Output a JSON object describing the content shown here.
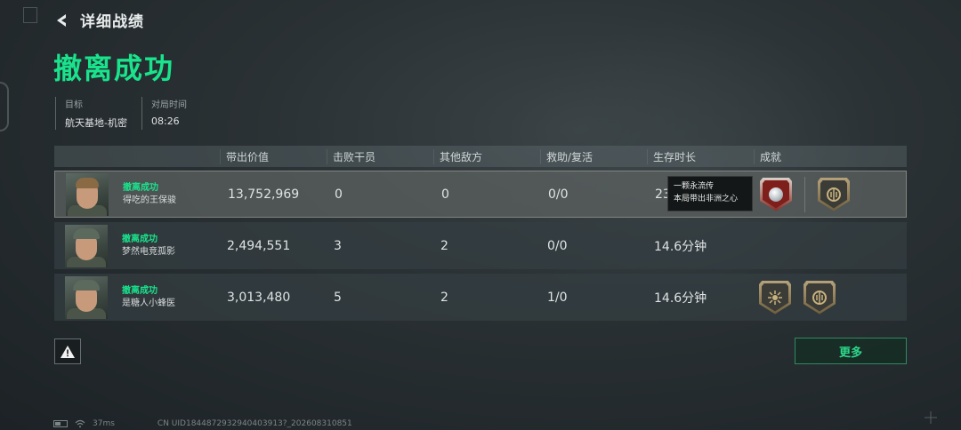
{
  "header": {
    "title": "详细战绩"
  },
  "result_title": "撤离成功",
  "meta": [
    {
      "label": "目标",
      "value": "航天基地-机密"
    },
    {
      "label": "对局时间",
      "value": "08:26"
    }
  ],
  "table": {
    "headers": {
      "value": "带出价值",
      "kills": "击败干员",
      "other": "其他敌方",
      "assist": "救助/复活",
      "survive": "生存时长",
      "achievements": "成就"
    },
    "rows": [
      {
        "status": "撤离成功",
        "name": "得吃的王保骏",
        "value": "13,752,969",
        "kills": "0",
        "other": "0",
        "assist": "0/0",
        "survive": "23"
      },
      {
        "status": "撤离成功",
        "name": "梦然电竞孤影",
        "value": "2,494,551",
        "kills": "3",
        "other": "2",
        "assist": "0/0",
        "survive": "14.6分钟"
      },
      {
        "status": "撤离成功",
        "name": "是糖人小蜂医",
        "value": "3,013,480",
        "kills": "5",
        "other": "2",
        "assist": "1/0",
        "survive": "14.6分钟"
      }
    ]
  },
  "tooltip": {
    "line1": "一颗永流传",
    "line2": "本局带出非洲之心"
  },
  "buttons": {
    "more": "更多"
  },
  "footer": {
    "ping": "37ms",
    "uid": "CN UID1844872932940403913?_202608310851"
  },
  "colors": {
    "accent": "#19e38c",
    "more_border": "#2f8a5f"
  }
}
